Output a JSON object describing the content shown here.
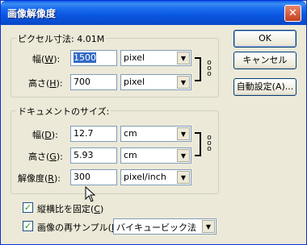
{
  "window": {
    "title": "画像解像度"
  },
  "pixel_dimensions": {
    "group_title": "ピクセル寸法: 4.01M",
    "width": {
      "label": "幅",
      "accel": "W",
      "value": "1500",
      "unit": "pixel"
    },
    "height": {
      "label": "高さ",
      "accel": "H",
      "value": "700",
      "unit": "pixel"
    }
  },
  "document_size": {
    "group_title": "ドキュメントのサイズ:",
    "width": {
      "label": "幅",
      "accel": "D",
      "value": "12.7",
      "unit": "cm"
    },
    "height": {
      "label": "高さ",
      "accel": "G",
      "value": "5.93",
      "unit": "cm"
    },
    "resolution": {
      "label": "解像度",
      "accel": "R",
      "value": "300",
      "unit": "pixel/inch"
    }
  },
  "options": {
    "constrain": {
      "label": "縦横比を固定",
      "accel": "C",
      "checked": true
    },
    "resample": {
      "label": "画像の再サンプル",
      "accel": "I",
      "checked": true,
      "method": "バイキュービック法"
    }
  },
  "buttons": {
    "ok": "OK",
    "cancel": "キャンセル",
    "auto": "自動設定(A)..."
  }
}
